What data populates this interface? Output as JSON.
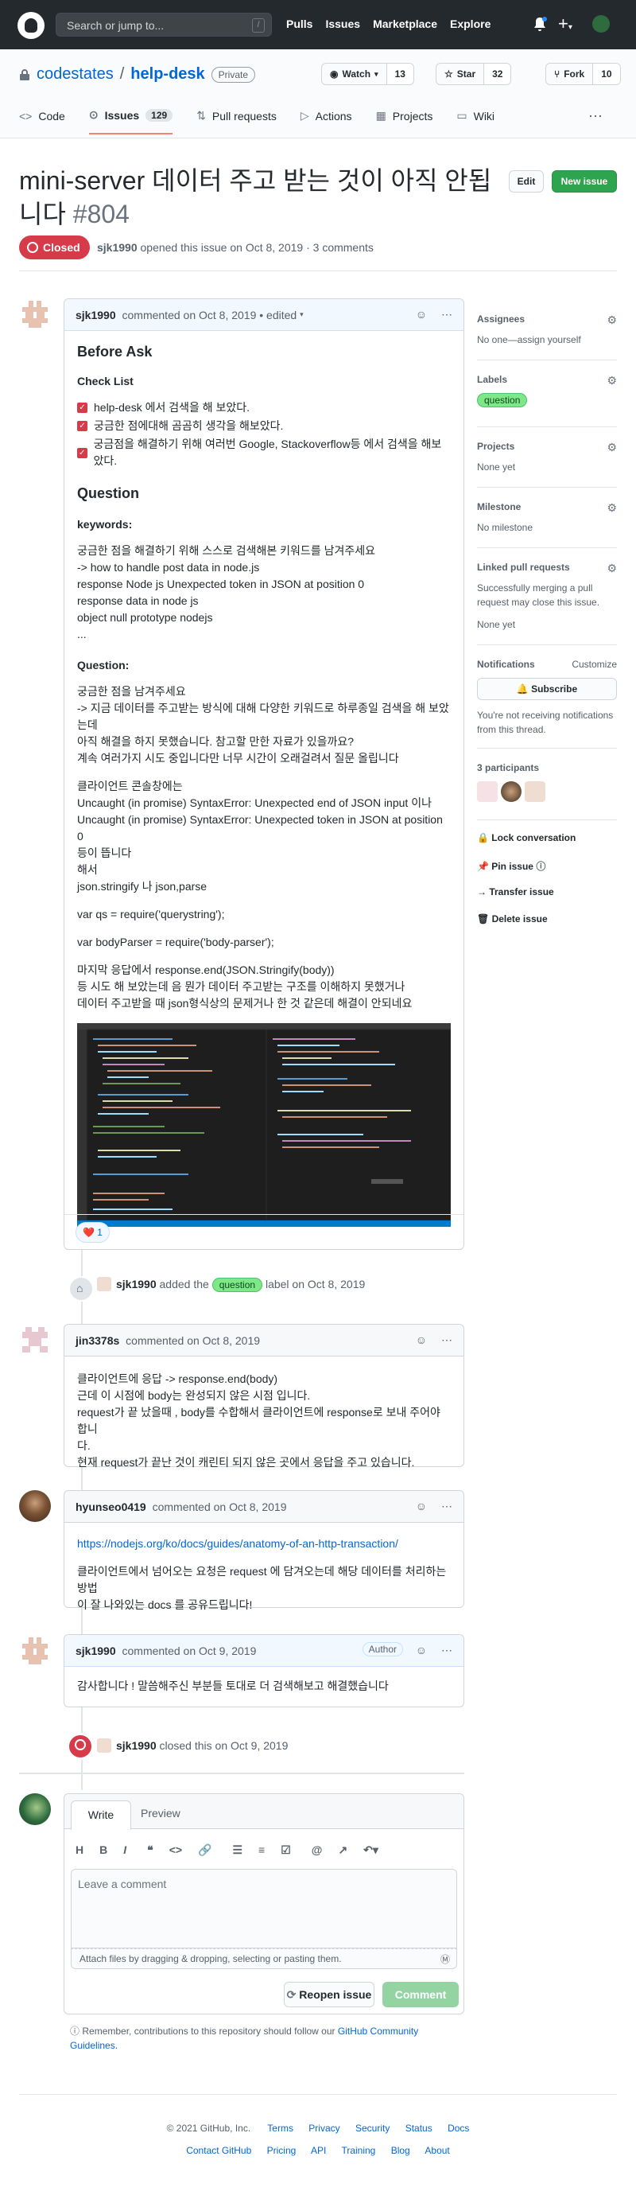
{
  "header": {
    "search_placeholder": "Search or jump to...",
    "slash": "/",
    "nav": [
      "Pulls",
      "Issues",
      "Marketplace",
      "Explore"
    ]
  },
  "repo": {
    "owner": "codestates",
    "sep": "/",
    "name": "help-desk",
    "visibility": "Private",
    "watch_label": "Watch",
    "watch_count": "13",
    "star_label": "Star",
    "star_count": "32",
    "fork_label": "Fork",
    "fork_count": "10",
    "tabs": [
      {
        "label": "Code"
      },
      {
        "label": "Issues",
        "count": "129"
      },
      {
        "label": "Pull requests"
      },
      {
        "label": "Actions"
      },
      {
        "label": "Projects"
      },
      {
        "label": "Wiki"
      }
    ]
  },
  "issue": {
    "title": "mini-server 데이터 주고 받는 것이 아직 안됩니다",
    "number": "#804",
    "edit_label": "Edit",
    "new_issue_label": "New issue",
    "state": "Closed",
    "author": "sjk1990",
    "meta": "opened this issue on Oct 8, 2019 · 3 comments"
  },
  "first_comment": {
    "author": "sjk1990",
    "meta": "commented on Oct 8, 2019",
    "edited": "• edited",
    "h_before": "Before Ask",
    "h_check": "Check List",
    "checks": [
      "help-desk 에서 검색을 해 보았다.",
      "궁금한 점에대해 곰곰히 생각을 해보았다.",
      "궁금점을 해결하기 위해 여러번 Google, Stackoverflow등 에서 검색을 해보았다."
    ],
    "h_question": "Question",
    "keywords_label": "keywords:",
    "kw_lines": [
      "궁금한 점을 해결하기 위해 스스로 검색해본 키워드를 남겨주세요",
      "-> how to handle post data in node.js",
      "response Node js Unexpected token in JSON at position 0",
      "response data in node js",
      "object null prototype nodejs",
      "..."
    ],
    "question_label": "Question:",
    "q_lines": [
      "궁금한 점을 남겨주세요",
      "-> 지금 데이터를 주고받는 방식에 대해 다양한 키워드로 하루종일 검색을 해 보았는데",
      "아직 해결을 하지 못했습니다. 참고할 만한 자료가 있을까요?",
      "계속 여러가지 시도 중입니다만 너무 시간이 오래걸려서 질문 올립니다"
    ],
    "p2_lines": [
      "클라이언트 콘솔창에는",
      "Uncaught (in promise) SyntaxError: Unexpected end of JSON input 이나",
      "Uncaught (in promise) SyntaxError: Unexpected token in JSON at position 0",
      "등이 뜹니다",
      "해서",
      "json.stringify 나 json,parse"
    ],
    "code1": "var qs = require('querystring');",
    "code2": "var bodyParser = require('body-parser');",
    "p3_lines": [
      "마지막 응답에서 response.end(JSON.Stringify(body))",
      "등 시도 해 보았는데 음 뭔가 데이터 주고받는 구조를 이해하지 못했거나",
      "데이터 주고받을 때 json형식상의 문제거나 한 것 같은데 해결이 안되네요"
    ],
    "reaction": "1"
  },
  "label_event": {
    "author": "sjk1990",
    "pre": "added the",
    "label": "question",
    "post": "label on Oct 8, 2019"
  },
  "comment2": {
    "author": "jin3378s",
    "meta": "commented on Oct 8, 2019",
    "lines": [
      "클라이언트에 응답 -> response.end(body)",
      "근데 이 시점에 body는 완성되지 않은 시점 입니다.",
      "request가 끝 났을때 , body를 수합해서 클라이언트에 response로 보내 주어야 합니",
      "다.",
      "현재 request가 끝난 것이 캐린티 되지 않은 곳에서 응답을 주고 있습니다."
    ]
  },
  "comment3": {
    "author": "hyunseo0419",
    "meta": "commented on Oct 8, 2019",
    "link": "https://nodejs.org/ko/docs/guides/anatomy-of-an-http-transaction/",
    "lines": [
      "클라이언트에서 넘어오는 요청은 request 에 담겨오는데 해당 데이터를 처리하는 방법",
      "이 잘 나와있는 docs 를 공유드립니다!"
    ]
  },
  "comment4": {
    "author": "sjk1990",
    "meta": "commented on Oct 9, 2019",
    "badge": "Author",
    "text": "감사합니다 ! 말씀해주신 부분들 토대로 더 검색해보고 해결했습니다"
  },
  "close_event": {
    "author": "sjk1990",
    "text": "closed this on Oct 9, 2019"
  },
  "composer": {
    "tab_write": "Write",
    "tab_preview": "Preview",
    "placeholder": "Leave a comment",
    "attach": "Attach files by dragging & dropping, selecting or pasting them.",
    "reopen": "Reopen issue",
    "comment": "Comment",
    "notice_pre": "Remember, contributions to this repository should follow our",
    "notice_link": "GitHub Community",
    "notice_link2": "Guidelines."
  },
  "sidebar": {
    "assignees_h": "Assignees",
    "assignees_v": "No one—assign yourself",
    "labels_h": "Labels",
    "label": "question",
    "projects_h": "Projects",
    "projects_v": "None yet",
    "milestone_h": "Milestone",
    "milestone_v": "No milestone",
    "linked_h": "Linked pull requests",
    "linked_v1": "Successfully merging a pull",
    "linked_v2": "request may close this issue.",
    "linked_v3": "None yet",
    "notif_h": "Notifications",
    "customize": "Customize",
    "subscribe": "Subscribe",
    "notif_v1": "You're not receiving notifications",
    "notif_v2": "from this thread.",
    "participants": "3 participants",
    "lock": "Lock conversation",
    "pin": "Pin issue",
    "transfer": "Transfer issue",
    "delete": "Delete issue"
  },
  "footer": {
    "copy": "© 2021 GitHub, Inc.",
    "row1": [
      "Terms",
      "Privacy",
      "Security",
      "Status",
      "Docs"
    ],
    "row2": [
      "Contact GitHub",
      "Pricing",
      "API",
      "Training",
      "Blog",
      "About"
    ]
  },
  "colors": {
    "closed": "#d73a49",
    "green": "#2ea44f",
    "link": "#0366d6",
    "label": "#7ee787"
  }
}
